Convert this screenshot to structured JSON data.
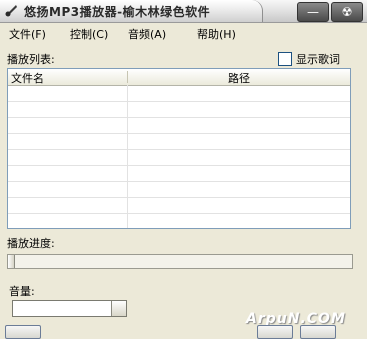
{
  "window": {
    "title": "悠扬MP3播放器-榆木林绿色软件",
    "minimize_label": "—",
    "close_label": "☢"
  },
  "menu": {
    "items": [
      {
        "label": "文件(F)"
      },
      {
        "label": "控制(C)"
      },
      {
        "label": "音频(A)"
      },
      {
        "label": "帮助(H)"
      }
    ]
  },
  "playlist": {
    "label": "播放列表:",
    "show_lyrics_label": "显示歌词",
    "show_lyrics_checked": false,
    "columns": [
      "文件名",
      "路径"
    ],
    "rows": []
  },
  "progress": {
    "label": "播放进度:",
    "value": 0
  },
  "volume": {
    "label": "音量:",
    "value": 1.0
  },
  "watermark": "ArpuN.COM",
  "colors": {
    "window_bg": "#ece9d8",
    "border": "#7f9db9"
  }
}
